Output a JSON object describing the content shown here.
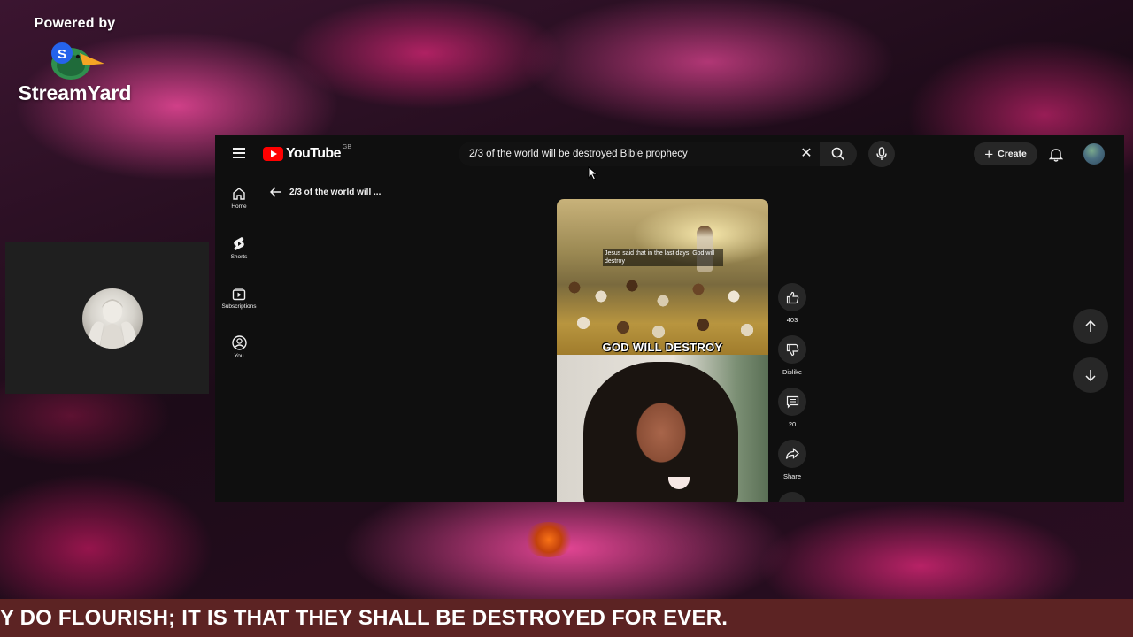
{
  "branding": {
    "powered_by": "Powered by",
    "name": "StreamYard"
  },
  "youtube": {
    "logo_text": "YouTube",
    "country_code": "GB",
    "search": {
      "value": "2/3 of the world will be destroyed Bible prophecy",
      "clear_icon": "close-icon",
      "search_icon": "search-icon",
      "mic_icon": "mic-icon"
    },
    "create_label": "Create",
    "guide": [
      {
        "label": "Home",
        "icon": "home-icon"
      },
      {
        "label": "Shorts",
        "icon": "shorts-icon"
      },
      {
        "label": "Subscriptions",
        "icon": "subscriptions-icon"
      },
      {
        "label": "You",
        "icon": "you-icon"
      }
    ],
    "back_title": "2/3 of the world will ...",
    "short": {
      "overlay_caption": "Jesus said that in the last days, God will destroy",
      "big_caption": "GOD WILL DESTROY"
    },
    "actions": {
      "like_count": "403",
      "dislike_label": "Dislike",
      "comment_count": "20",
      "share_label": "Share"
    }
  },
  "ticker": {
    "text": "Y DO FLOURISH; IT IS THAT THEY SHALL BE DESTROYED FOR EVER."
  },
  "colors": {
    "youtube_red": "#ff0000",
    "yt_background": "#0f0f0f",
    "ticker_background": "#5c2323"
  }
}
